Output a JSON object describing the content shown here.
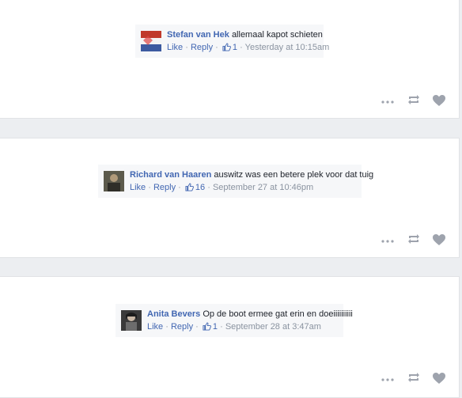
{
  "comments": [
    {
      "author": "Stefan van Hek",
      "text": "allemaal kapot schieten",
      "like_label": "Like",
      "reply_label": "Reply",
      "like_count": "1",
      "timestamp": "Yesterday at 10:15am"
    },
    {
      "author": "Richard van Haaren",
      "text": "auswitz was een betere plek voor dat tuig",
      "like_label": "Like",
      "reply_label": "Reply",
      "like_count": "16",
      "timestamp": "September 27 at 10:46pm"
    },
    {
      "author": "Anita Bevers",
      "text": "Op de boot ermee gat erin en doeiiiiiiiiii",
      "like_label": "Like",
      "reply_label": "Reply",
      "like_count": "1",
      "timestamp": "September 28 at 3:47am"
    }
  ],
  "separator": "·",
  "icons": {
    "more": "more-dots-icon",
    "repost": "repost-icon",
    "heart": "heart-icon",
    "like": "thumbs-up-icon"
  },
  "colors": {
    "link": "#4267b2",
    "meta": "#8a93a0",
    "icon": "#9ea3ad"
  }
}
